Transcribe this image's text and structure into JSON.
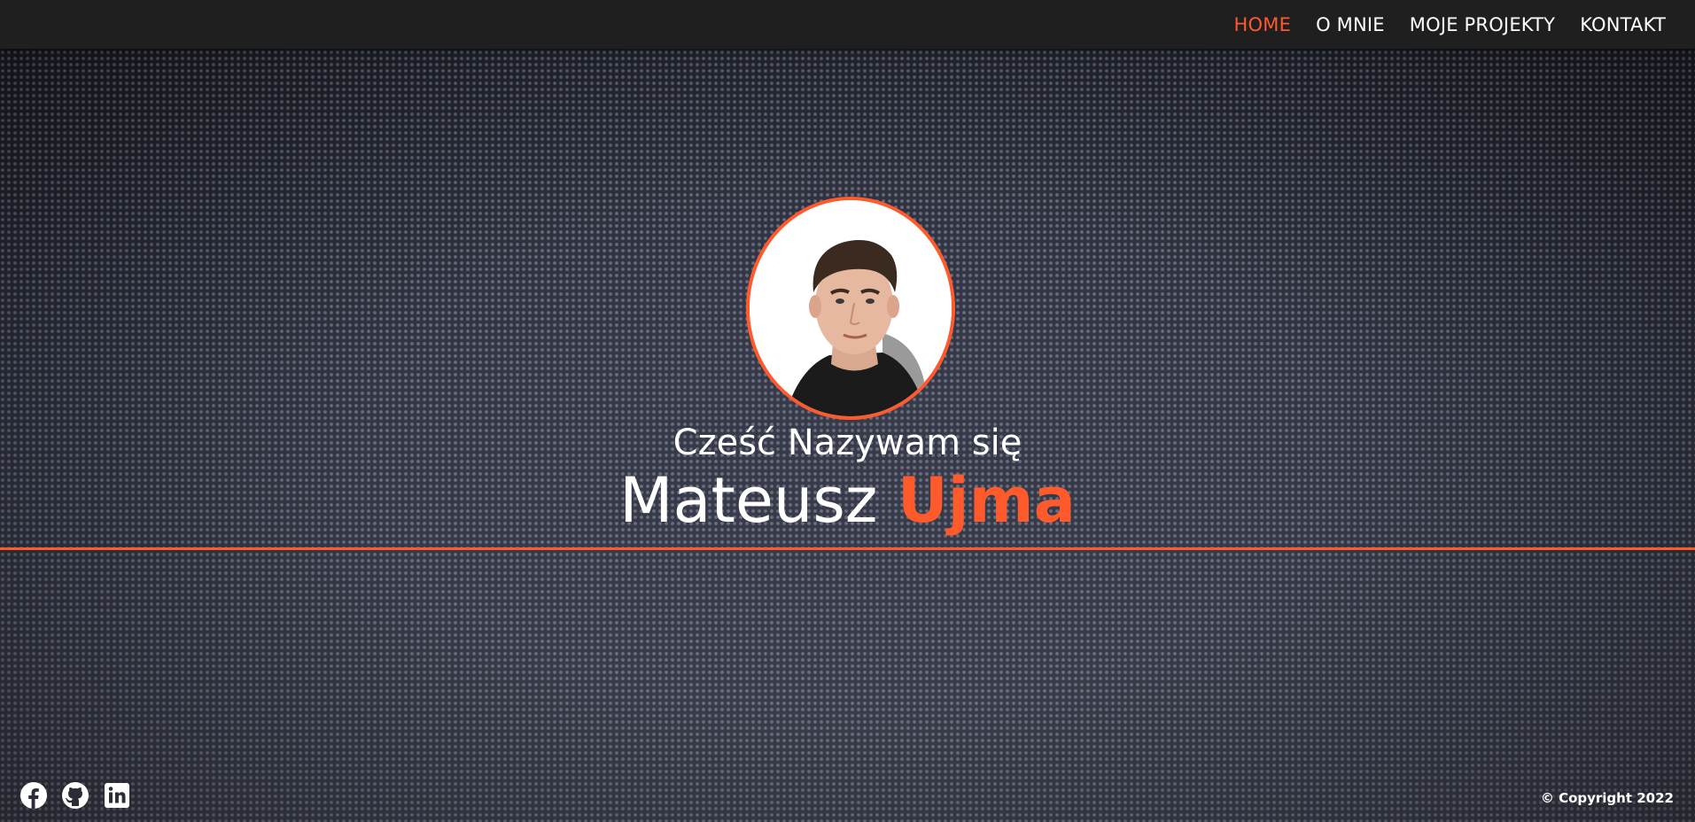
{
  "nav": {
    "items": [
      {
        "label": "HOME",
        "active": true
      },
      {
        "label": "O MNIE",
        "active": false
      },
      {
        "label": "MOJE PROJEKTY",
        "active": false
      },
      {
        "label": "KONTAKT",
        "active": false
      }
    ]
  },
  "hero": {
    "greeting": "Cześć Nazywam się",
    "first_name": "Mateusz",
    "last_name": "Ujma",
    "avatar_icon": "profile-photo"
  },
  "footer": {
    "socials": [
      {
        "name": "facebook",
        "icon": "facebook-icon"
      },
      {
        "name": "github",
        "icon": "github-icon"
      },
      {
        "name": "linkedin",
        "icon": "linkedin-icon"
      }
    ],
    "copyright": "© Copyright 2022"
  },
  "colors": {
    "accent": "#ff5a2c",
    "topbar": "#1f1f1f",
    "text": "#ffffff"
  }
}
